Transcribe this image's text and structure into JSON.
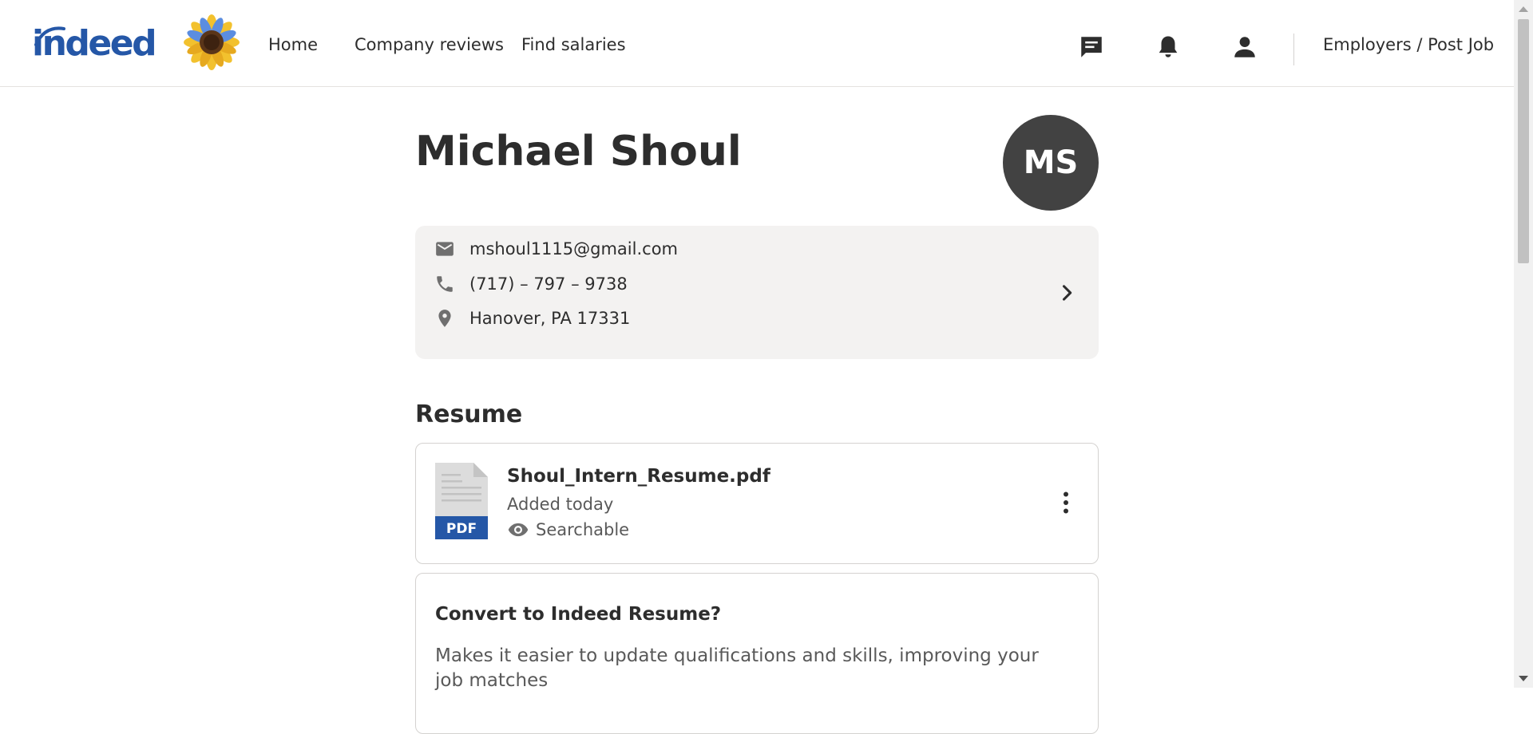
{
  "header": {
    "logo_text": "indeed",
    "nav": [
      {
        "label": "Home"
      },
      {
        "label": "Company reviews"
      },
      {
        "label": "Find salaries"
      }
    ],
    "icons": [
      "messages-icon",
      "notifications-bell-icon",
      "account-person-icon"
    ],
    "employers_link": "Employers / Post Job"
  },
  "profile": {
    "name": "Michael Shoul",
    "initials": "MS",
    "email": "mshoul1115@gmail.com",
    "phone": "(717) – 797 – 9738",
    "location": "Hanover, PA 17331"
  },
  "resume": {
    "section_title": "Resume",
    "file_name": "Shoul_Intern_Resume.pdf",
    "file_type_badge": "PDF",
    "added": "Added today",
    "visibility": "Searchable"
  },
  "convert": {
    "title": "Convert to Indeed Resume?",
    "description": "Makes it easier to update qualifications and skills, improving your job matches"
  },
  "colors": {
    "brand_blue": "#2557a7",
    "text": "#2d2d2d",
    "muted_text": "#595959",
    "card_bg": "#f3f2f1",
    "avatar_bg": "#424242",
    "border": "#d4d2d0"
  }
}
